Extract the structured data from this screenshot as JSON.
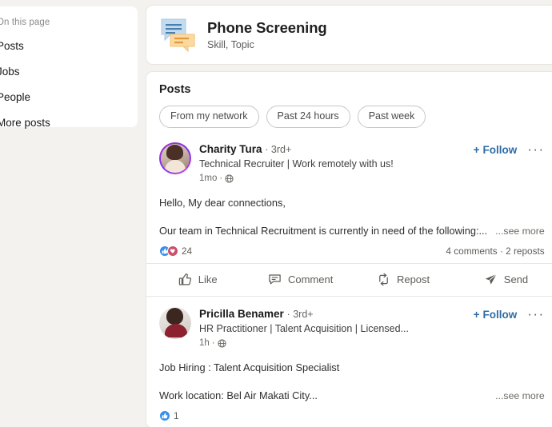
{
  "sidebar": {
    "title": "On this page",
    "items": [
      {
        "label": "Posts",
        "name": "posts"
      },
      {
        "label": "Jobs",
        "name": "jobs"
      },
      {
        "label": "People",
        "name": "people"
      },
      {
        "label": "More posts",
        "name": "more-posts"
      }
    ]
  },
  "entity": {
    "title": "Phone Screening",
    "subtitle": "Skill, Topic",
    "icon": "chat-bubbles-icon"
  },
  "posts_section": {
    "heading": "Posts",
    "filters": [
      {
        "label": "From my network",
        "name": "from-my-network"
      },
      {
        "label": "Past 24 hours",
        "name": "past-24-hours"
      },
      {
        "label": "Past week",
        "name": "past-week"
      }
    ]
  },
  "actions": [
    {
      "label": "Like",
      "icon": "thumbs-up-icon",
      "name": "like"
    },
    {
      "label": "Comment",
      "icon": "comment-bubble-icon",
      "name": "comment"
    },
    {
      "label": "Repost",
      "icon": "repost-arrows-icon",
      "name": "repost"
    },
    {
      "label": "Send",
      "icon": "paper-plane-icon",
      "name": "send"
    }
  ],
  "follow_label": "+ Follow",
  "posts": [
    {
      "author": "Charity Tura",
      "degree": "· 3rd+",
      "headline": "Technical Recruiter | Work remotely with us!",
      "time": "1mo",
      "visibility": "globe-icon",
      "follow": "Follow",
      "body_line1": "Hello, My dear connections,",
      "body_line2": "Our team in Technical Recruitment is currently in need of the following:...",
      "see_more": "...see more",
      "reaction_count": "24",
      "counts": "4 comments · 2 reposts",
      "has_actions": true
    },
    {
      "author": "Pricilla Benamer",
      "degree": "· 3rd+",
      "headline": "HR Practitioner | Talent Acquisition | Licensed...",
      "time": "1h",
      "visibility": "globe-icon",
      "follow": "Follow",
      "body_line1": "Job Hiring : Talent Acquisition Specialist",
      "body_line2": "Work location: Bel Air Makati City...",
      "see_more": "...see more",
      "reaction_count": "1",
      "counts": "",
      "has_actions": false
    }
  ],
  "colors": {
    "page_bg": "#f4f2ee",
    "card_bg": "#ffffff",
    "link_blue": "#2f6ca8",
    "text_primary": "#191919",
    "text_secondary": "#5e5c58",
    "icon_blue": "#b9d2e8",
    "icon_orange": "#f5c98a"
  }
}
